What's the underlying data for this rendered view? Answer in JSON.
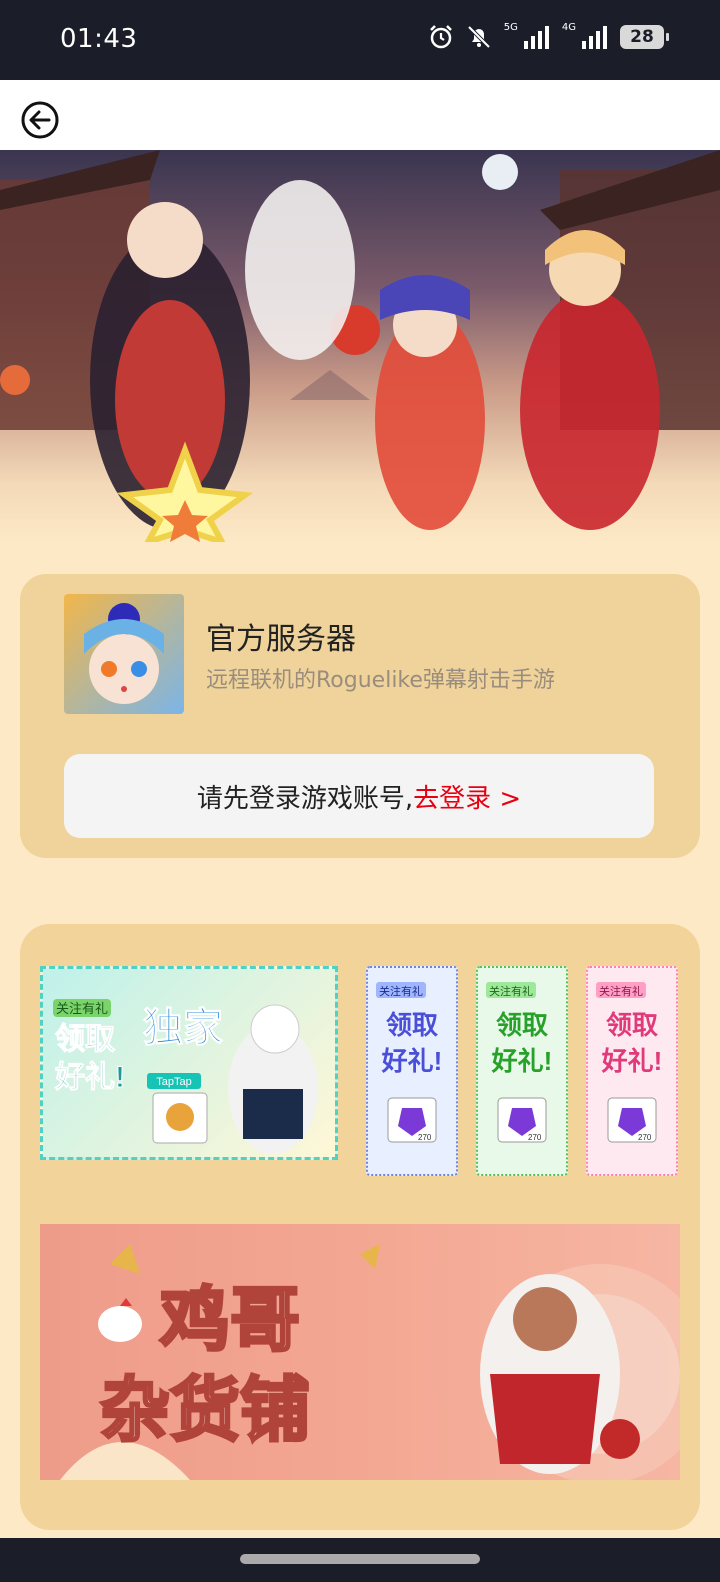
{
  "status_bar": {
    "time": "01:43",
    "network_1": "5G",
    "network_2": "4G",
    "battery": "28"
  },
  "server": {
    "title": "官方服务器",
    "subtitle": "远程联机的Roguelike弹幕射击手游"
  },
  "login": {
    "prompt": "请先登录游戏账号,",
    "link": "去登录 >"
  },
  "promos": {
    "main_badge": "关注有礼",
    "main_text_1": "领取",
    "main_text_2": "独家",
    "main_text_3": "好礼!",
    "main_platform": "TapTap",
    "small_badge": "关注有礼",
    "small_text_1": "领取",
    "small_text_2": "好礼!",
    "small_count": "270"
  },
  "shop_banner": {
    "line1": "鸡哥",
    "line2": "杂货铺"
  },
  "colors": {
    "accent_red": "#e60012",
    "page_bg": "#fde9c6",
    "card_bg": "#efd39a"
  }
}
